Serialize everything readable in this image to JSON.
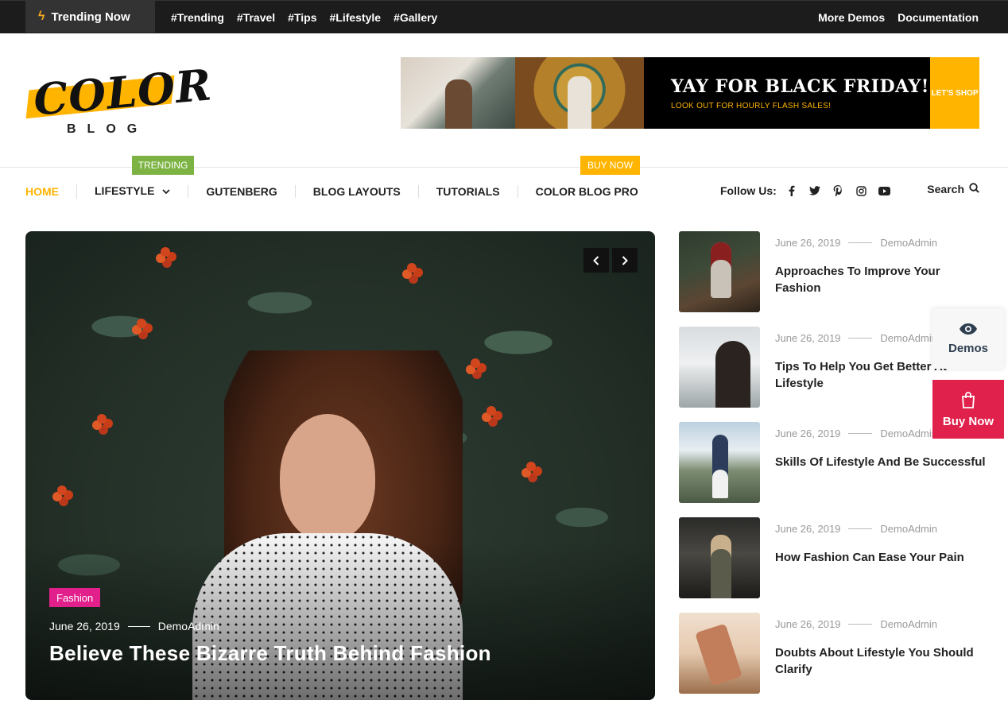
{
  "topbar": {
    "trending_label": "Trending Now",
    "tags": [
      "#Trending",
      "#Travel",
      "#Tips",
      "#Lifestyle",
      "#Gallery"
    ],
    "links": [
      "More Demos",
      "Documentation"
    ]
  },
  "logo": {
    "word": "COLOR",
    "sub": "BLOG"
  },
  "banner": {
    "headline": "YAY FOR BLACK FRIDAY!",
    "subline": "LOOK OUT FOR HOURLY FLASH SALES!",
    "cta": "LET'S SHOP"
  },
  "nav": {
    "badges": {
      "trending": "TRENDING",
      "buy_now": "BUY NOW"
    },
    "items": [
      "HOME",
      "LIFESTYLE",
      "GUTENBERG",
      "BLOG LAYOUTS",
      "TUTORIALS",
      "COLOR BLOG PRO"
    ],
    "follow_label": "Follow Us:",
    "social_icons": [
      "facebook-icon",
      "twitter-icon",
      "pinterest-icon",
      "instagram-icon",
      "youtube-icon"
    ],
    "search_label": "Search"
  },
  "hero": {
    "category": "Fashion",
    "date": "June 26, 2019",
    "author": "DemoAdmin",
    "title": "Believe These Bizarre Truth Behind Fashion"
  },
  "posts": [
    {
      "date": "June 26, 2019",
      "author": "DemoAdmin",
      "title": "Approaches To Improve Your Fashion"
    },
    {
      "date": "June 26, 2019",
      "author": "DemoAdmin",
      "title": "Tips To Help You Get Better At Lifestyle"
    },
    {
      "date": "June 26, 2019",
      "author": "DemoAdmin",
      "title": "Skills Of Lifestyle And Be Successful"
    },
    {
      "date": "June 26, 2019",
      "author": "DemoAdmin",
      "title": "How Fashion Can Ease Your Pain"
    },
    {
      "date": "June 26, 2019",
      "author": "DemoAdmin",
      "title": "Doubts About Lifestyle You Should Clarify"
    }
  ],
  "floating": {
    "demos_label": "Demos",
    "buy_label": "Buy Now"
  },
  "colors": {
    "accent": "#ffb400",
    "trending_badge": "#7cb342",
    "fashion_badge": "#e2208c",
    "buy_now": "#e0214b"
  }
}
